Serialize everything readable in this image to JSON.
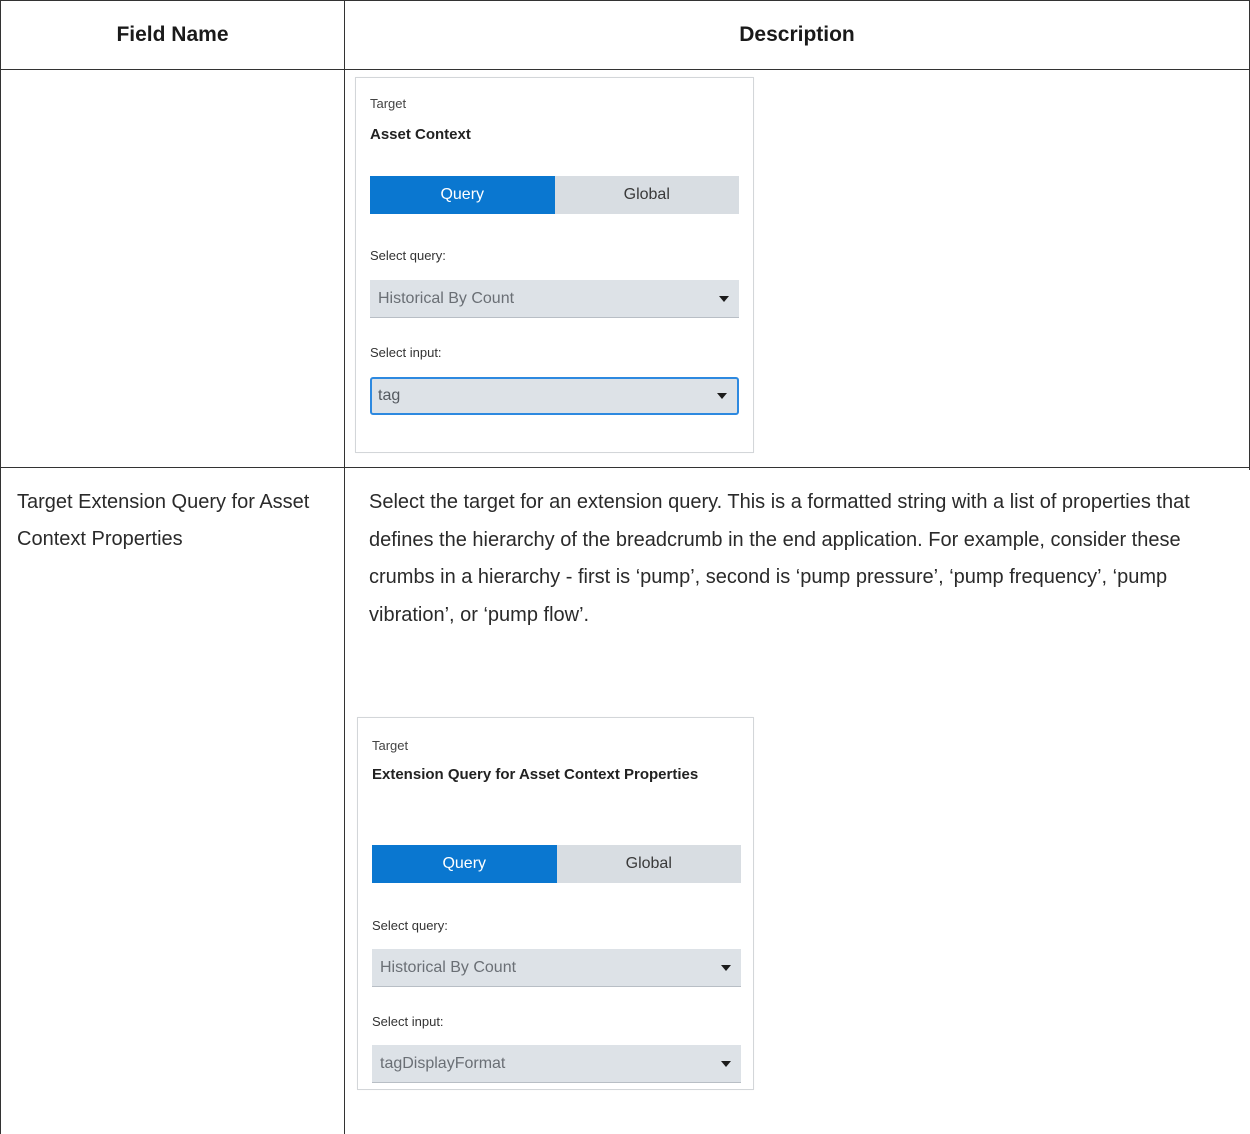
{
  "table": {
    "headers": {
      "field_name": "Field Name",
      "description": "Description"
    },
    "rows": [
      {
        "field_name": "",
        "panel": {
          "target_label": "Target",
          "title": "Asset Context",
          "segments": [
            "Query",
            "Global"
          ],
          "active_segment": "Query",
          "select_query_label": "Select query:",
          "select_query_value": "Historical By Count",
          "select_input_label": "Select input:",
          "select_input_value": "tag"
        }
      },
      {
        "field_name": "Target Extension Query for Asset Context Properties",
        "description": "Select the target for an extension query. This is a formatted string with a list of properties that defines the hierarchy of the breadcrumb in the end application. For example, consider these crumbs in a hierarchy - first is ‘pump’, second is ‘pump pressure’, ‘pump frequency’, ‘pump vibration’, or ‘pump flow’.",
        "panel": {
          "target_label": "Target",
          "title": "Extension Query for Asset Context Properties",
          "segments": [
            "Query",
            "Global"
          ],
          "active_segment": "Query",
          "select_query_label": "Select query:",
          "select_query_value": "Historical By Count",
          "select_input_label": "Select input:",
          "select_input_value": "tagDisplayFormat"
        }
      }
    ]
  },
  "colors": {
    "accent": "#0a77d0",
    "segment_inactive": "#d8dde2",
    "select_bg": "#dde2e7",
    "focus_border": "#2d89e0",
    "grid_line": "#333333"
  },
  "icons": {
    "dropdown": "caret-down-icon"
  }
}
